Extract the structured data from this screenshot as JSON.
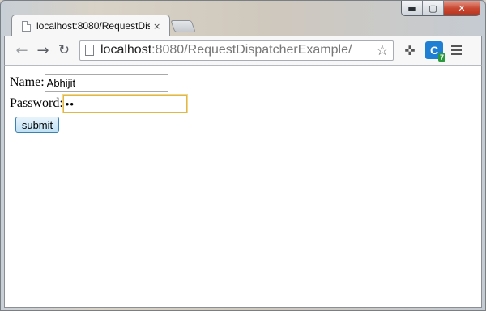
{
  "window": {
    "minimize_glyph": "▬",
    "maximize_glyph": "▢",
    "close_glyph": "✕"
  },
  "tabs": [
    {
      "title": "localhost:8080/RequestDis",
      "close_glyph": "×"
    }
  ],
  "toolbar": {
    "back_glyph": "←",
    "forward_glyph": "→",
    "reload_glyph": "↻",
    "url_host": "localhost",
    "url_path": ":8080/RequestDispatcherExample/",
    "star_glyph": "☆",
    "extension_label": "C",
    "extension_badge": "7"
  },
  "form": {
    "name_label": "Name:",
    "name_value": "Abhijit",
    "password_label": "Password:",
    "password_value": "••",
    "submit_label": "submit"
  }
}
